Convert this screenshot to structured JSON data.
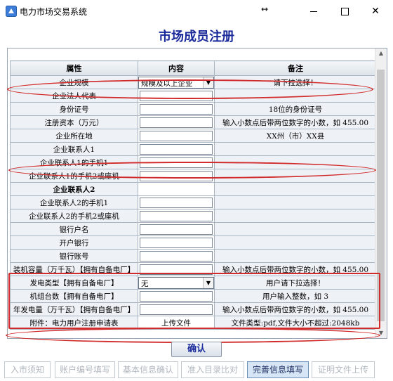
{
  "window": {
    "title": "电力市场交易系统",
    "resize_glyph": "↔",
    "close_glyph": "✕"
  },
  "page": {
    "heading": "市场成员注册"
  },
  "table": {
    "headers": [
      "属性",
      "内容",
      "备注"
    ],
    "rows": [
      {
        "label": "企业规模",
        "type": "select",
        "value": "规模及以上企业",
        "note": "请下拉选择！"
      },
      {
        "label": "企业法人代表",
        "type": "input",
        "value": "",
        "note": ""
      },
      {
        "label": "身份证号",
        "type": "input",
        "value": "",
        "note": "18位的身份证号"
      },
      {
        "label": "注册资本（万元）",
        "type": "input",
        "value": "",
        "note": "输入小数点后带两位数字的小数，如 455.00"
      },
      {
        "label": "企业所在地",
        "type": "input",
        "value": "",
        "note": "XX州（市）XX县"
      },
      {
        "label": "企业联系人1",
        "type": "input",
        "value": "",
        "note": ""
      },
      {
        "label": "企业联系人1的手机1",
        "type": "input",
        "value": "",
        "note": ""
      },
      {
        "label": "企业联系人1的手机2或座机",
        "type": "input",
        "value": "",
        "note": ""
      },
      {
        "label": "企业联系人2",
        "type": "section",
        "value": "",
        "note": ""
      },
      {
        "label": "企业联系人2的手机1",
        "type": "input",
        "value": "",
        "note": ""
      },
      {
        "label": "企业联系人2的手机2或座机",
        "type": "input",
        "value": "",
        "note": ""
      },
      {
        "label": "银行户名",
        "type": "input",
        "value": "",
        "note": ""
      },
      {
        "label": "开户银行",
        "type": "input",
        "value": "",
        "note": ""
      },
      {
        "label": "银行账号",
        "type": "input",
        "value": "",
        "note": ""
      },
      {
        "label": "装机容量（万千瓦）【拥有自备电厂】",
        "type": "input",
        "value": "",
        "note": "输入小数点后带两位数字的小数，如 455.00"
      },
      {
        "label": "发电类型【拥有自备电厂】",
        "type": "select",
        "value": "无",
        "note": "用户请下拉选择！"
      },
      {
        "label": "机组台数【拥有自备电厂】",
        "type": "input",
        "value": "",
        "note": "用户输入整数，如 3"
      },
      {
        "label": "年发电量（万千瓦）【拥有自备电厂】",
        "type": "input",
        "value": "",
        "note": "输入小数点后带两位数字的小数，如 455.00"
      },
      {
        "label": "附件：电力用户注册申请表",
        "type": "upload",
        "value": "上传文件",
        "note": "文件类型:pdf,文件大小不超过:2048kb"
      }
    ]
  },
  "confirm_label": "确认",
  "steps": [
    {
      "label": "入市须知",
      "active": false
    },
    {
      "label": "账户编号填写",
      "active": false
    },
    {
      "label": "基本信息确认",
      "active": false
    },
    {
      "label": "准入目录比对",
      "active": false
    },
    {
      "label": "完善信息填写",
      "active": true
    },
    {
      "label": "证明文件上传",
      "active": false
    }
  ],
  "colors": {
    "annotation": "#d12b2b",
    "heading": "#1a2a9a",
    "active_step": "#d6e6f7"
  }
}
